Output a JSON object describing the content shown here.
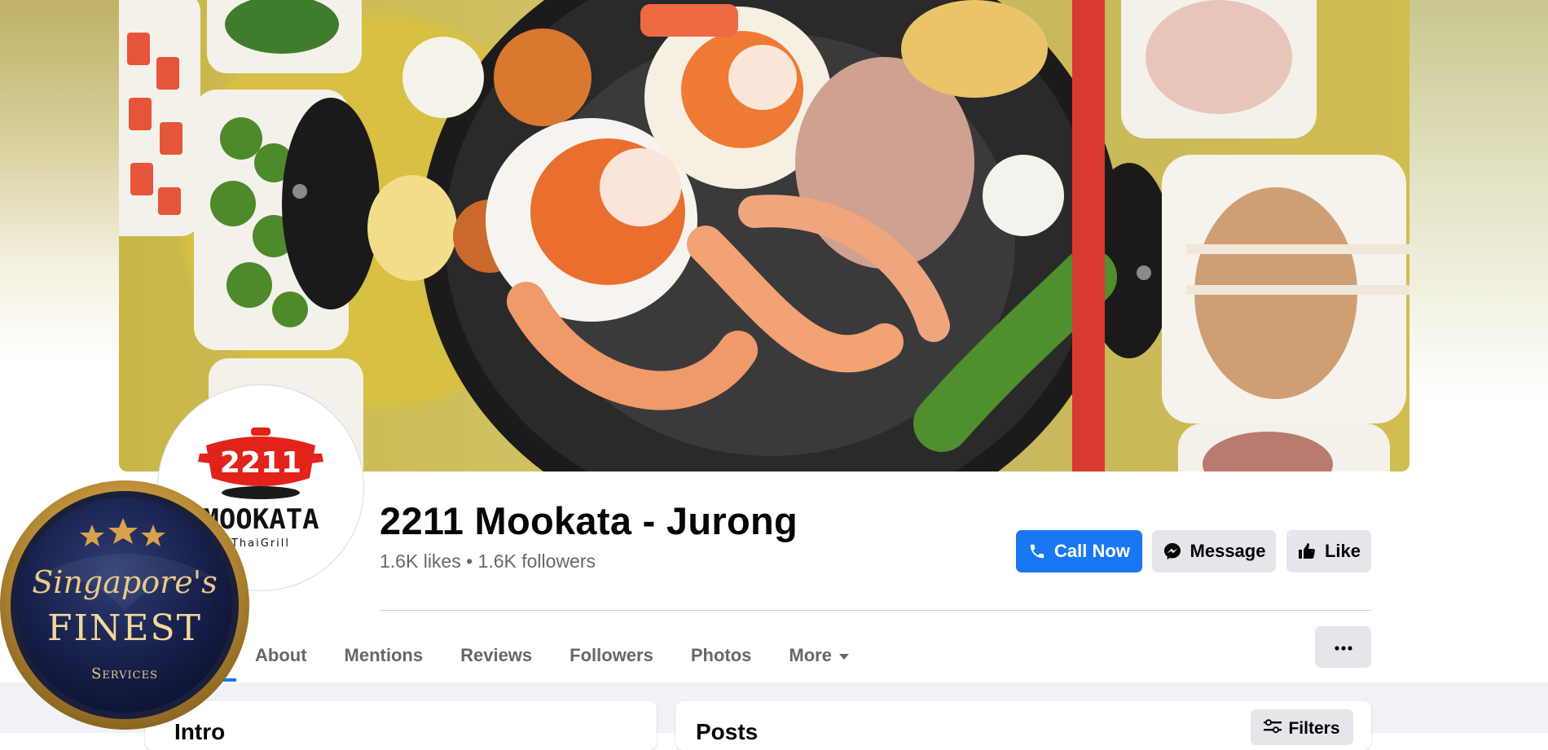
{
  "page": {
    "name": "2211 Mookata - Jurong",
    "stats": "1.6K likes • 1.6K followers"
  },
  "logo": {
    "pot_text": "2211",
    "brand": "MOOKATA",
    "tagline": "ThaiGrill"
  },
  "actions": {
    "call": "Call Now",
    "message": "Message",
    "like": "Like"
  },
  "tabs": {
    "about": "About",
    "mentions": "Mentions",
    "reviews": "Reviews",
    "followers": "Followers",
    "photos": "Photos",
    "more": "More"
  },
  "sections": {
    "intro": "Intro",
    "posts": "Posts",
    "filters": "Filters"
  },
  "badge": {
    "script": "Singapore's",
    "title": "FINEST",
    "subtitle": "Services"
  },
  "colors": {
    "accent": "#1877f2",
    "secondary_button": "#e4e6eb",
    "muted_text": "#65676b"
  },
  "icons": [
    "phone-icon",
    "messenger-icon",
    "thumbs-up-icon",
    "caret-down-icon",
    "ellipsis-icon",
    "filters-icon"
  ]
}
